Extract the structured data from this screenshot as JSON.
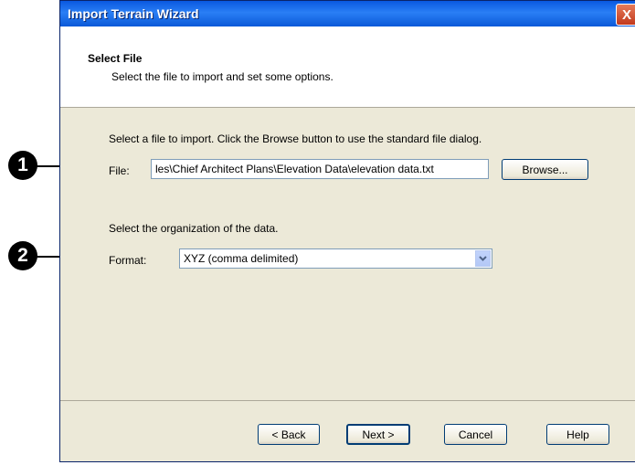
{
  "window": {
    "title": "Import Terrain Wizard",
    "close_glyph": "X"
  },
  "header": {
    "title": "Select File",
    "subtitle": "Select the file to import and set some options."
  },
  "file_section": {
    "instruction": "Select a file to import. Click the Browse button to use the standard file dialog.",
    "label": "File:",
    "value": "les\\Chief Architect Plans\\Elevation Data\\elevation data.txt",
    "browse_label": "Browse..."
  },
  "format_section": {
    "instruction": "Select the organization of the data.",
    "label": "Format:",
    "selected": "XYZ (comma delimited)"
  },
  "footer": {
    "back_label": "< Back",
    "next_label": "Next >",
    "cancel_label": "Cancel",
    "help_label": "Help"
  },
  "callouts": [
    "1",
    "2"
  ],
  "colors": {
    "titlebar": "#0a58e0",
    "dialog_bg": "#ece9d8",
    "close_button": "#c1391e"
  },
  "icons": {
    "close": "close-icon",
    "dropdown": "chevron-down-icon"
  }
}
